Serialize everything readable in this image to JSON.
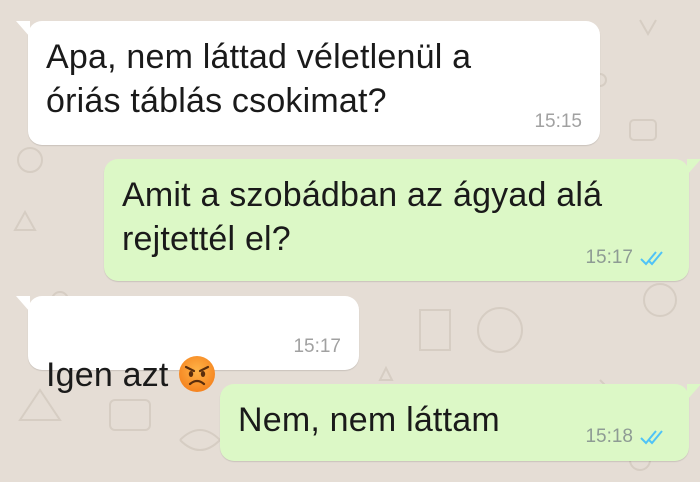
{
  "theme": {
    "incoming_bg": "#ffffff",
    "outgoing_bg": "#dcf8c6",
    "read_tick_color": "#4fc3f7"
  },
  "messages": [
    {
      "direction": "incoming",
      "text": "Apa, nem láttad véletlenül a\nóriás táblás csokimat?",
      "time": "15:15"
    },
    {
      "direction": "outgoing",
      "text": "Amit a szobádban az ágyad alá\nrejtettél el?",
      "time": "15:17",
      "status": "read-double-check-icon"
    },
    {
      "direction": "incoming",
      "text": "Igen azt",
      "emoji": "angry-face-icon",
      "time": "15:17"
    },
    {
      "direction": "outgoing",
      "text": "Nem, nem láttam",
      "time": "15:18",
      "status": "read-double-check-icon"
    }
  ]
}
